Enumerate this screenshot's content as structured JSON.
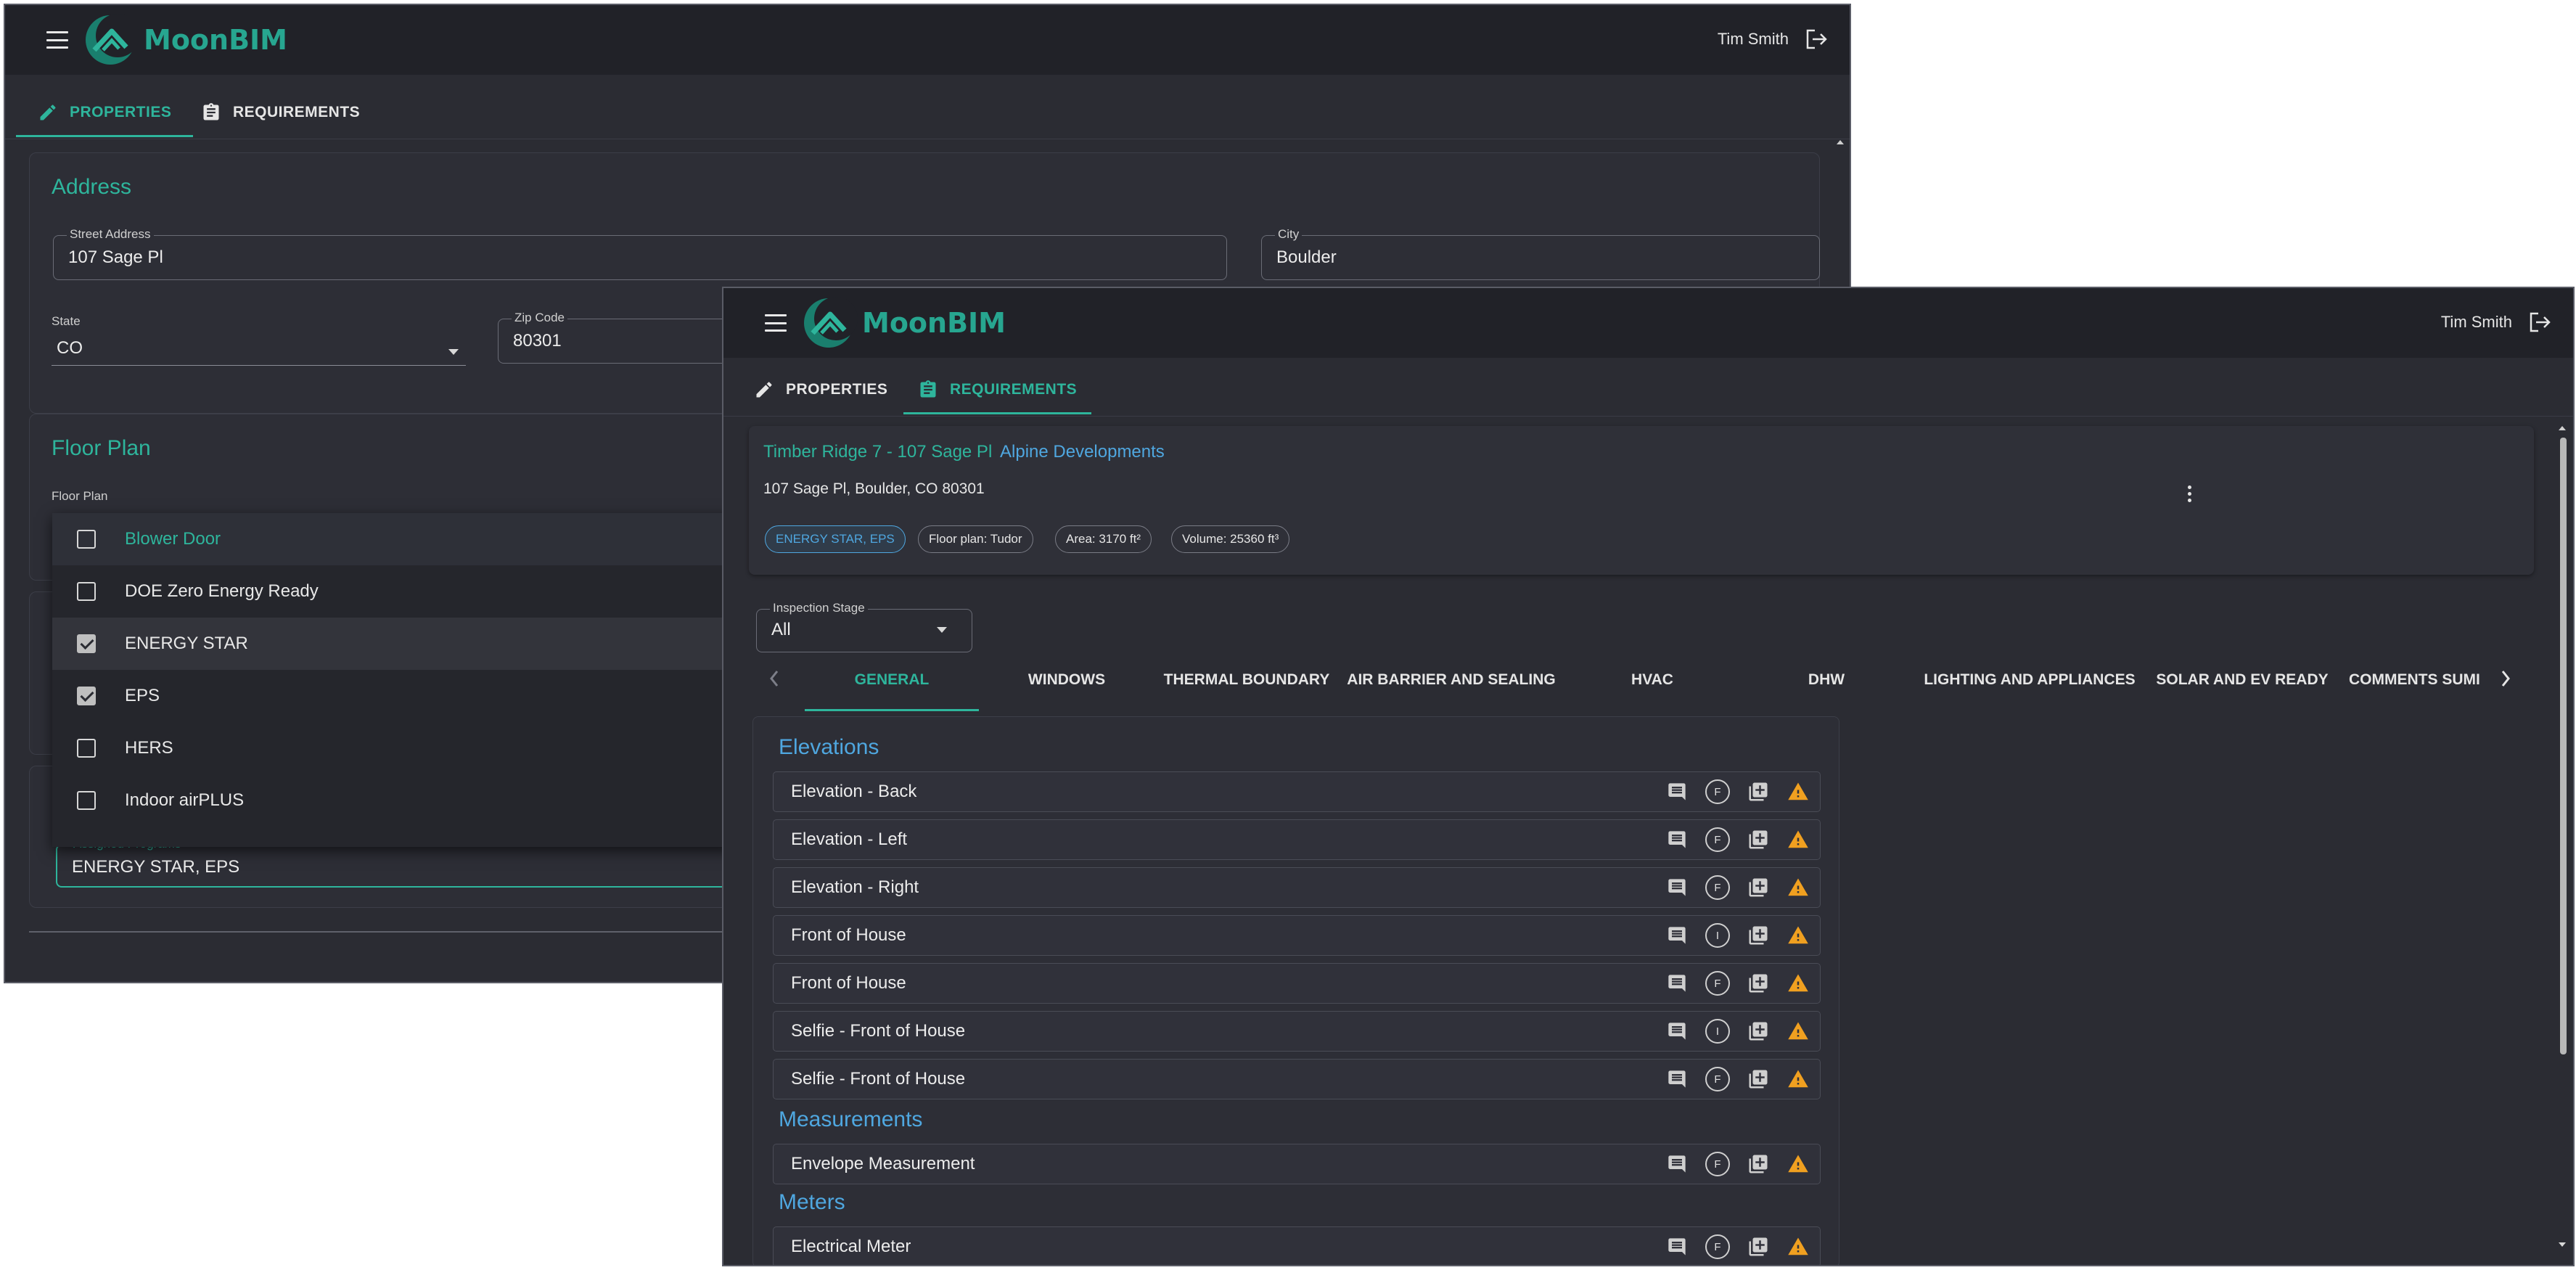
{
  "colors": {
    "accent_teal": "#2eb59c",
    "accent_blue": "#4fa7e0",
    "warning": "#f0a020",
    "background": "#2b2c33",
    "appbar": "#212228"
  },
  "app": {
    "name": "MoonBIM",
    "user": "Tim Smith",
    "menu_icon": "menu-icon",
    "logout_icon": "logout-icon"
  },
  "window1": {
    "tabs": [
      {
        "label": "PROPERTIES",
        "icon": "pencil-icon"
      },
      {
        "label": "REQUIREMENTS",
        "icon": "clipboard-icon"
      }
    ],
    "address": {
      "title": "Address",
      "street_label": "Street Address",
      "street_value": "107 Sage Pl",
      "city_label": "City",
      "city_value": "Boulder",
      "state_label": "State",
      "state_value": "CO",
      "zip_label": "Zip Code",
      "zip_value": "80301"
    },
    "floor_plan": {
      "title": "Floor Plan",
      "field_label": "Floor Plan"
    },
    "programs": {
      "field_label": "Assigned Programs",
      "field_value": "ENERGY STAR, EPS",
      "options": [
        {
          "label": "Blower Door",
          "checked": false
        },
        {
          "label": "DOE Zero Energy Ready",
          "checked": false
        },
        {
          "label": "ENERGY STAR",
          "checked": true
        },
        {
          "label": "EPS",
          "checked": true
        },
        {
          "label": "HERS",
          "checked": false
        },
        {
          "label": "Indoor airPLUS",
          "checked": false
        }
      ]
    }
  },
  "window2": {
    "tabs": [
      {
        "label": "PROPERTIES",
        "icon": "pencil-icon"
      },
      {
        "label": "REQUIREMENTS",
        "icon": "clipboard-icon"
      }
    ],
    "project": {
      "title": "Timber Ridge 7 - 107 Sage Pl",
      "builder": "Alpine Developments",
      "address": "107 Sage Pl, Boulder, CO 80301",
      "chips": [
        "ENERGY STAR, EPS",
        "Floor plan: Tudor",
        "Area: 3170 ft²",
        "Volume: 25360 ft³"
      ]
    },
    "inspection_stage": {
      "label": "Inspection Stage",
      "value": "All"
    },
    "subtabs": [
      "GENERAL",
      "WINDOWS",
      "THERMAL BOUNDARY",
      "AIR BARRIER AND SEALING",
      "HVAC",
      "DHW",
      "LIGHTING AND APPLIANCES",
      "SOLAR AND EV READY",
      "COMMENTS SUMI"
    ],
    "groups": [
      {
        "title": "Elevations",
        "items": [
          {
            "name": "Elevation - Back",
            "badge": "F"
          },
          {
            "name": "Elevation - Left",
            "badge": "F"
          },
          {
            "name": "Elevation - Right",
            "badge": "F"
          },
          {
            "name": "Front of House",
            "badge": "I"
          },
          {
            "name": "Front of House",
            "badge": "F"
          },
          {
            "name": "Selfie - Front of House",
            "badge": "I"
          },
          {
            "name": "Selfie - Front of House",
            "badge": "F"
          }
        ]
      },
      {
        "title": "Measurements",
        "items": [
          {
            "name": "Envelope Measurement",
            "badge": "F"
          }
        ]
      },
      {
        "title": "Meters",
        "items": [
          {
            "name": "Electrical Meter",
            "badge": "F"
          }
        ]
      }
    ]
  }
}
